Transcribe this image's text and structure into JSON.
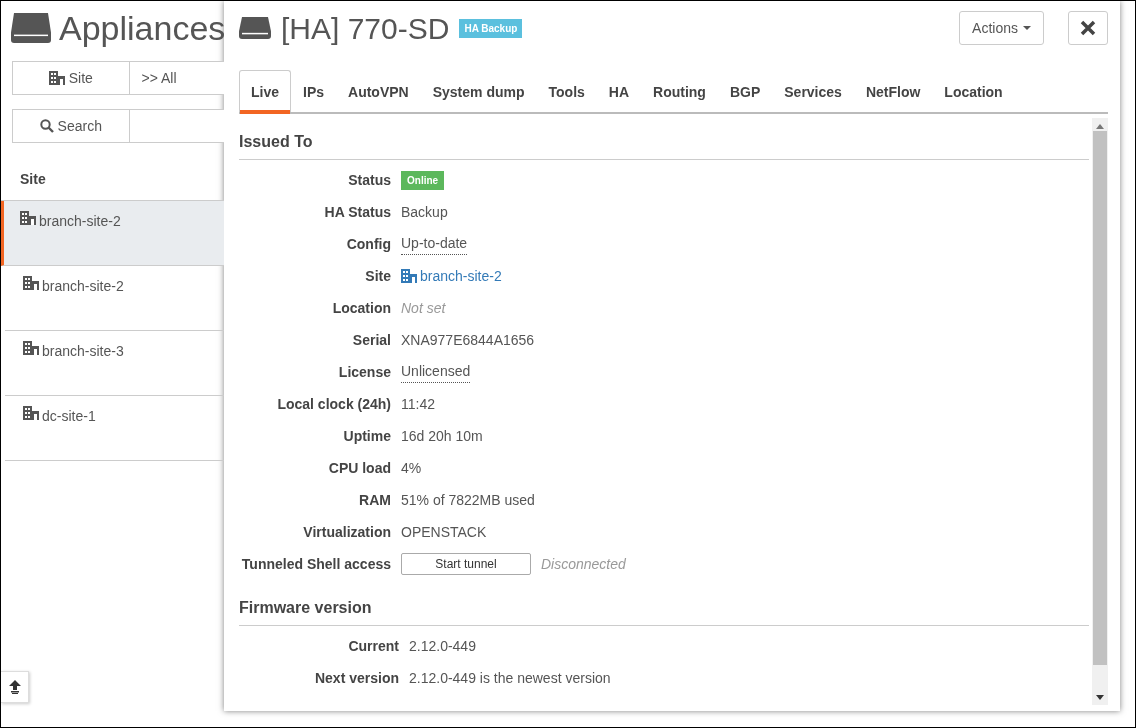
{
  "background": {
    "title": "Appliances",
    "site_filter": "Site",
    "scope_filter": ">> All",
    "search": "Search",
    "column": "Site",
    "sites": [
      {
        "name": "branch-site-2",
        "selected": true
      },
      {
        "name": "branch-site-2",
        "selected": false
      },
      {
        "name": "branch-site-3",
        "selected": false
      },
      {
        "name": "dc-site-1",
        "selected": false
      }
    ]
  },
  "panel": {
    "title": "[HA] 770-SD",
    "badge": "HA Backup",
    "actions": "Actions",
    "tabs": [
      {
        "label": "Live",
        "selected": true
      },
      {
        "label": "IPs",
        "selected": false
      },
      {
        "label": "AutoVPN",
        "selected": false
      },
      {
        "label": "System dump",
        "selected": false
      },
      {
        "label": "Tools",
        "selected": false
      },
      {
        "label": "HA",
        "selected": false
      },
      {
        "label": "Routing",
        "selected": false
      },
      {
        "label": "BGP",
        "selected": false
      },
      {
        "label": "Services",
        "selected": false
      },
      {
        "label": "NetFlow",
        "selected": false
      },
      {
        "label": "Location",
        "selected": false
      }
    ],
    "sections": [
      {
        "title": "Issued To",
        "rows": [
          {
            "label": "Status",
            "kind": "badge",
            "value": "Online"
          },
          {
            "label": "HA Status",
            "kind": "text",
            "value": "Backup"
          },
          {
            "label": "Config",
            "kind": "dotted",
            "value": "Up-to-date"
          },
          {
            "label": "Site",
            "kind": "link",
            "value": "branch-site-2"
          },
          {
            "label": "Location",
            "kind": "muted",
            "value": "Not set"
          },
          {
            "label": "Serial",
            "kind": "text",
            "value": "XNA977E6844A1656"
          },
          {
            "label": "License",
            "kind": "dotted",
            "value": "Unlicensed"
          },
          {
            "label": "Local clock (24h)",
            "kind": "text",
            "value": "11:42"
          },
          {
            "label": "Uptime",
            "kind": "text",
            "value": "16d 20h 10m"
          },
          {
            "label": "CPU load",
            "kind": "text",
            "value": "4%"
          },
          {
            "label": "RAM",
            "kind": "text",
            "value": "51% of 7822MB used"
          },
          {
            "label": "Virtualization",
            "kind": "text",
            "value": "OPENSTACK"
          },
          {
            "label": "Tunneled Shell access",
            "kind": "button",
            "value": "Start tunnel",
            "note": "Disconnected"
          }
        ]
      },
      {
        "title": "Firmware version",
        "rows": [
          {
            "label": "Current",
            "kind": "text",
            "value": "2.12.0-449"
          },
          {
            "label": "Next version",
            "kind": "text",
            "value": "2.12.0-449 is the newest version"
          }
        ]
      }
    ]
  }
}
